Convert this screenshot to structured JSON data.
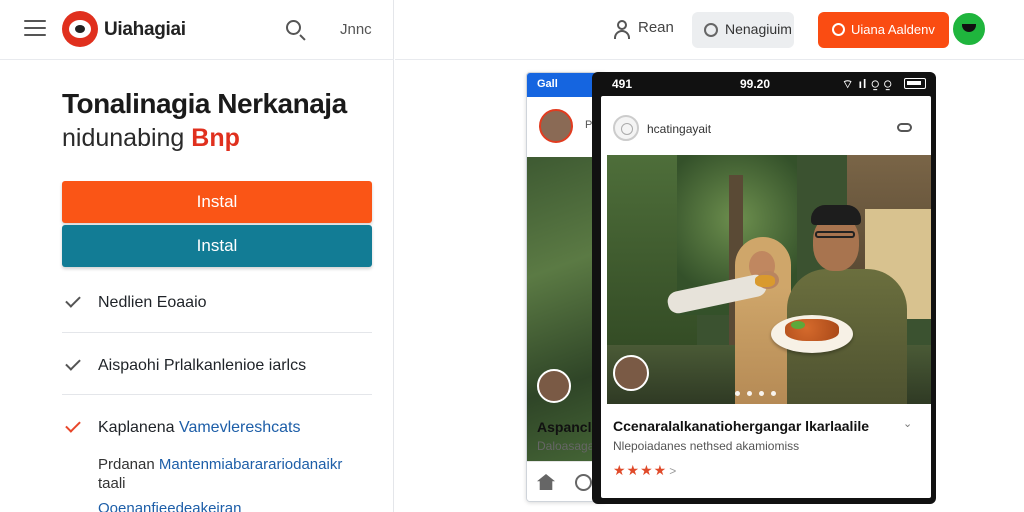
{
  "left_header": {
    "brand": "Uiahagiai",
    "top_link": "Jnnc"
  },
  "hero": {
    "title": "Tonalinagia Nerkanaja",
    "subtitle_prefix": "nidunabing",
    "subtitle_accent": "Bnp"
  },
  "buttons": {
    "primary_label": "Instal",
    "secondary_label": "Instal"
  },
  "features": [
    {
      "label": "Nedlien Eoaaio"
    },
    {
      "label": "Aispaohi Prlalkanlenioe iarlcs"
    },
    {
      "label_dark": "Kaplanena",
      "label_blue": "Vamevlereshcats"
    }
  ],
  "feature_note": {
    "line1_dark": "Prdanan",
    "line1_blue": "Mantenmiabararariodanaikr",
    "line2": "taali",
    "line3": "Ooenanfieedeakeiran"
  },
  "right_header": {
    "user_label": "Rean",
    "ghost_button_label": "Nenagiuim",
    "cta_label": "Uiana Aaldenv"
  },
  "phone_back": {
    "status_text": "Gall",
    "initial": "P",
    "title": "Aspancla",
    "subtitle": "Daloasagan"
  },
  "phone_front": {
    "status_left": "491",
    "status_time": "99.20",
    "status_icons": "⌔ ıl ⍜ ⍜",
    "post_author": "hcatingayait",
    "caption_title": "Ccenaralalkanatiohergangar lkarlaalile",
    "caption_chevron": "⌄",
    "caption_desc": "Nlepoiadanes nethsed akamiomiss",
    "rating_stars": "★★★★",
    "rating_arrow": ">"
  },
  "colors": {
    "accent_orange": "#fa5516",
    "teal": "#127c95",
    "blue_text": "#1d5ea8",
    "logo_red": "#e0301e",
    "avatar_green": "#1fb53d"
  }
}
